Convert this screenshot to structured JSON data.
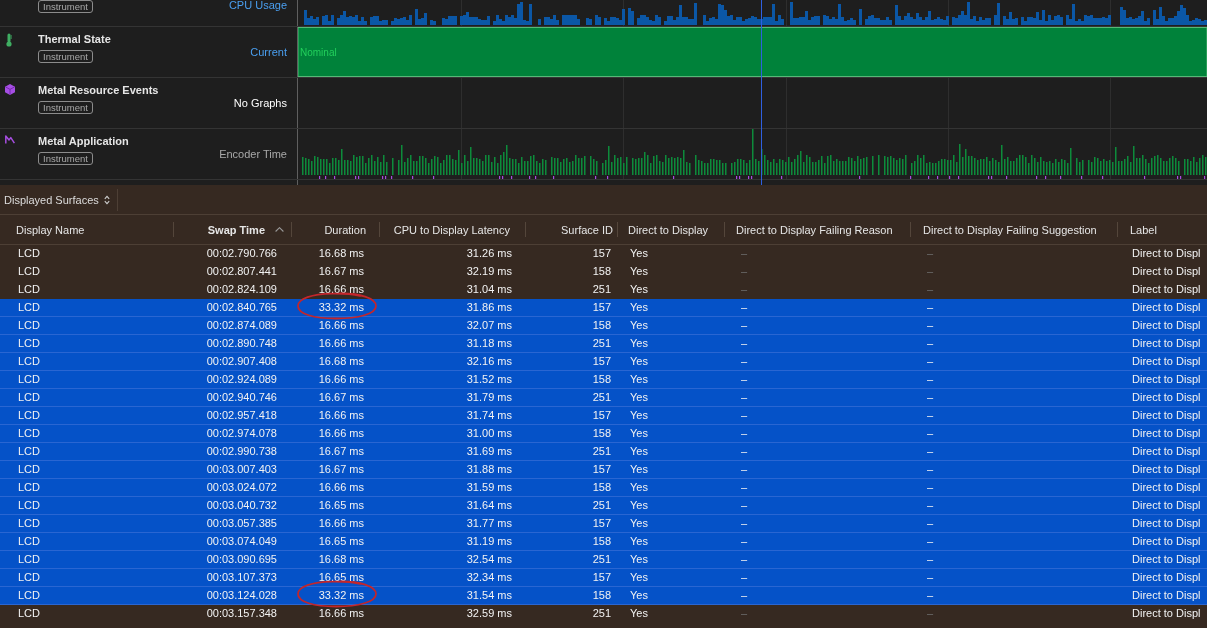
{
  "timeline": {
    "tracks": [
      {
        "badge": "Instrument",
        "graph_label": "CPU Usage",
        "link": true,
        "dimmed": false,
        "kind": "usage"
      },
      {
        "name": "Thermal State",
        "badge": "Instrument",
        "graph_label": "Current",
        "link": true,
        "dimmed": false,
        "kind": "state",
        "state_text": "Nominal"
      },
      {
        "name": "Metal Resource Events",
        "badge": "Instrument",
        "graph_label": "No Graphs",
        "link": false,
        "dimmed": false,
        "kind": "none"
      },
      {
        "name": "Metal Application",
        "badge": "Instrument",
        "graph_label": "Encoder Time",
        "link": false,
        "dimmed": true,
        "kind": "encoder"
      }
    ]
  },
  "table": {
    "selector": "Displayed Surfaces",
    "columns": [
      {
        "label": "Display Name",
        "sorted": false
      },
      {
        "label": "Swap Time",
        "sorted": true
      },
      {
        "label": "Duration",
        "sorted": false
      },
      {
        "label": "CPU to Display Latency",
        "sorted": false
      },
      {
        "label": "Surface ID",
        "sorted": false
      },
      {
        "label": "Direct to Display",
        "sorted": false
      },
      {
        "label": "Direct to Display Failing Reason",
        "sorted": false
      },
      {
        "label": "Direct to Display Failing Suggestion",
        "sorted": false
      },
      {
        "label": "Label",
        "sorted": false
      }
    ],
    "rows": [
      {
        "selected": false,
        "circled": false,
        "cells": [
          "LCD",
          "00:02.790.766",
          "16.68 ms",
          "31.26 ms",
          "157",
          "Yes",
          "–",
          "–",
          "Direct to Displ"
        ]
      },
      {
        "selected": false,
        "circled": false,
        "cells": [
          "LCD",
          "00:02.807.441",
          "16.67 ms",
          "32.19 ms",
          "158",
          "Yes",
          "–",
          "–",
          "Direct to Displ"
        ]
      },
      {
        "selected": false,
        "circled": false,
        "cells": [
          "LCD",
          "00:02.824.109",
          "16.66 ms",
          "31.04 ms",
          "251",
          "Yes",
          "–",
          "–",
          "Direct to Displ"
        ]
      },
      {
        "selected": true,
        "circled": true,
        "cells": [
          "LCD",
          "00:02.840.765",
          "33.32 ms",
          "31.86 ms",
          "157",
          "Yes",
          "–",
          "–",
          "Direct to Displ"
        ]
      },
      {
        "selected": true,
        "circled": false,
        "cells": [
          "LCD",
          "00:02.874.089",
          "16.66 ms",
          "32.07 ms",
          "158",
          "Yes",
          "–",
          "–",
          "Direct to Displ"
        ]
      },
      {
        "selected": true,
        "circled": false,
        "cells": [
          "LCD",
          "00:02.890.748",
          "16.66 ms",
          "31.18 ms",
          "251",
          "Yes",
          "–",
          "–",
          "Direct to Displ"
        ]
      },
      {
        "selected": true,
        "circled": false,
        "cells": [
          "LCD",
          "00:02.907.408",
          "16.68 ms",
          "32.16 ms",
          "157",
          "Yes",
          "–",
          "–",
          "Direct to Displ"
        ]
      },
      {
        "selected": true,
        "circled": false,
        "cells": [
          "LCD",
          "00:02.924.089",
          "16.66 ms",
          "31.52 ms",
          "158",
          "Yes",
          "–",
          "–",
          "Direct to Displ"
        ]
      },
      {
        "selected": true,
        "circled": false,
        "cells": [
          "LCD",
          "00:02.940.746",
          "16.67 ms",
          "31.79 ms",
          "251",
          "Yes",
          "–",
          "–",
          "Direct to Displ"
        ]
      },
      {
        "selected": true,
        "circled": false,
        "cells": [
          "LCD",
          "00:02.957.418",
          "16.66 ms",
          "31.74 ms",
          "157",
          "Yes",
          "–",
          "–",
          "Direct to Displ"
        ]
      },
      {
        "selected": true,
        "circled": false,
        "cells": [
          "LCD",
          "00:02.974.078",
          "16.66 ms",
          "31.00 ms",
          "158",
          "Yes",
          "–",
          "–",
          "Direct to Displ"
        ]
      },
      {
        "selected": true,
        "circled": false,
        "cells": [
          "LCD",
          "00:02.990.738",
          "16.67 ms",
          "31.69 ms",
          "251",
          "Yes",
          "–",
          "–",
          "Direct to Displ"
        ]
      },
      {
        "selected": true,
        "circled": false,
        "cells": [
          "LCD",
          "00:03.007.403",
          "16.67 ms",
          "31.88 ms",
          "157",
          "Yes",
          "–",
          "–",
          "Direct to Displ"
        ]
      },
      {
        "selected": true,
        "circled": false,
        "cells": [
          "LCD",
          "00:03.024.072",
          "16.66 ms",
          "31.59 ms",
          "158",
          "Yes",
          "–",
          "–",
          "Direct to Displ"
        ]
      },
      {
        "selected": true,
        "circled": false,
        "cells": [
          "LCD",
          "00:03.040.732",
          "16.65 ms",
          "31.64 ms",
          "251",
          "Yes",
          "–",
          "–",
          "Direct to Displ"
        ]
      },
      {
        "selected": true,
        "circled": false,
        "cells": [
          "LCD",
          "00:03.057.385",
          "16.66 ms",
          "31.77 ms",
          "157",
          "Yes",
          "–",
          "–",
          "Direct to Displ"
        ]
      },
      {
        "selected": true,
        "circled": false,
        "cells": [
          "LCD",
          "00:03.074.049",
          "16.65 ms",
          "31.19 ms",
          "158",
          "Yes",
          "–",
          "–",
          "Direct to Displ"
        ]
      },
      {
        "selected": true,
        "circled": false,
        "cells": [
          "LCD",
          "00:03.090.695",
          "16.68 ms",
          "32.54 ms",
          "251",
          "Yes",
          "–",
          "–",
          "Direct to Displ"
        ]
      },
      {
        "selected": true,
        "circled": false,
        "cells": [
          "LCD",
          "00:03.107.373",
          "16.65 ms",
          "32.34 ms",
          "157",
          "Yes",
          "–",
          "–",
          "Direct to Displ"
        ]
      },
      {
        "selected": true,
        "circled": true,
        "cells": [
          "LCD",
          "00:03.124.028",
          "33.32 ms",
          "31.54 ms",
          "158",
          "Yes",
          "–",
          "–",
          "Direct to Displ"
        ]
      },
      {
        "selected": false,
        "circled": false,
        "cells": [
          "LCD",
          "00:03.157.348",
          "16.66 ms",
          "32.59 ms",
          "251",
          "Yes",
          "–",
          "–",
          "Direct to Displ"
        ]
      }
    ]
  }
}
